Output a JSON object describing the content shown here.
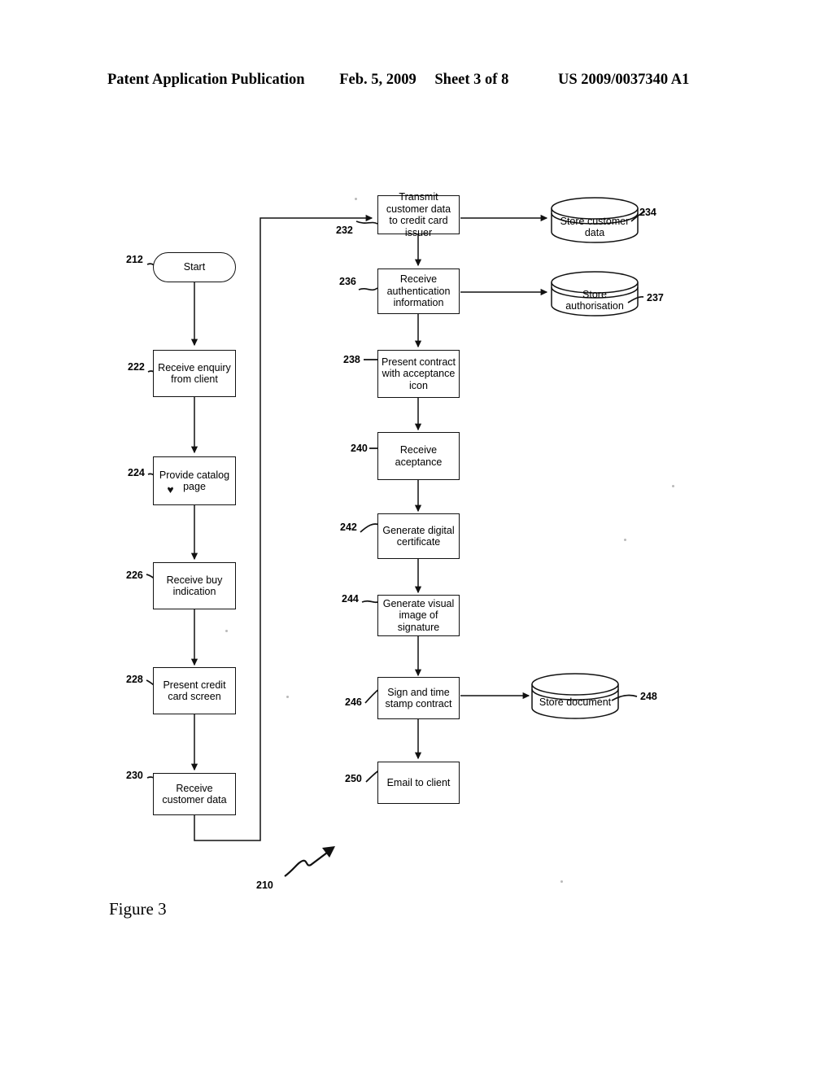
{
  "header": {
    "publication": "Patent Application Publication",
    "date": "Feb. 5, 2009",
    "sheet": "Sheet 3 of 8",
    "pub_number": "US 2009/0037340 A1"
  },
  "figure": {
    "caption": "Figure 3",
    "diagram_ref": "210"
  },
  "nodes": {
    "start": {
      "ref": "212",
      "label": "Start",
      "shape": "terminal"
    },
    "enquiry": {
      "ref": "222",
      "label": "Receive enquiry from client",
      "shape": "process"
    },
    "catalog": {
      "ref": "224",
      "label": "Provide catalog page",
      "shape": "process"
    },
    "buy": {
      "ref": "226",
      "label": "Receive buy indication",
      "shape": "process"
    },
    "credit": {
      "ref": "228",
      "label": "Present credit card screen",
      "shape": "process"
    },
    "custdata": {
      "ref": "230",
      "label": "Receive customer data",
      "shape": "process"
    },
    "transmit": {
      "ref": "232",
      "label": "Transmit customer data to credit card issuer",
      "shape": "process"
    },
    "storecust": {
      "ref": "234",
      "label": "Store customer data",
      "shape": "store"
    },
    "auth": {
      "ref": "236",
      "label": "Receive authentication information",
      "shape": "process"
    },
    "storeauth": {
      "ref": "237",
      "label": "Store authorisation",
      "shape": "store"
    },
    "contract": {
      "ref": "238",
      "label": "Present contract with acceptance icon",
      "shape": "process"
    },
    "acceptance": {
      "ref": "240",
      "label": "Receive aceptance",
      "shape": "process"
    },
    "certificate": {
      "ref": "242",
      "label": "Generate digital certificate",
      "shape": "process"
    },
    "signature": {
      "ref": "244",
      "label": "Generate visual image of signature",
      "shape": "process"
    },
    "signstamp": {
      "ref": "246",
      "label": "Sign and time stamp contract",
      "shape": "process"
    },
    "storedoc": {
      "ref": "248",
      "label": "Store document",
      "shape": "store"
    },
    "email": {
      "ref": "250",
      "label": "Email to client",
      "shape": "process"
    }
  },
  "colors": {
    "ink": "#111111",
    "paper": "#ffffff"
  }
}
